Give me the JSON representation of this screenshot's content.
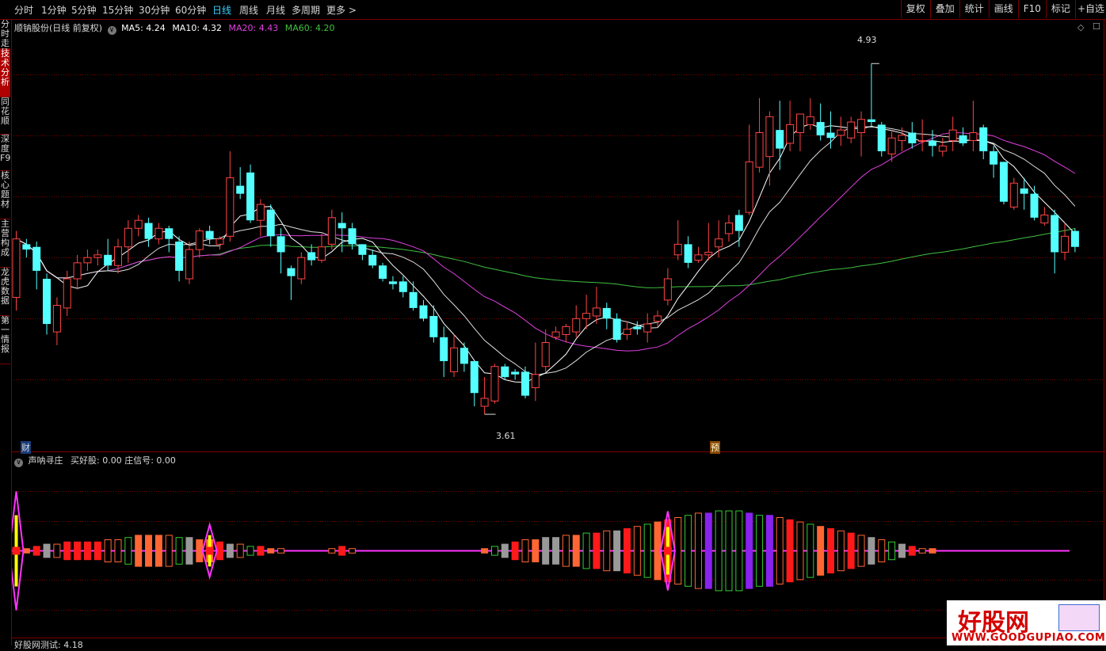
{
  "toolbar": {
    "periods": [
      "分时",
      "1分钟",
      "5分钟",
      "15分钟",
      "30分钟",
      "60分钟",
      "日线",
      "周线",
      "月线",
      "多周期",
      "更多 >"
    ],
    "active_period": "日线",
    "right_tools": [
      "复权",
      "叠加",
      "统计",
      "画线",
      "F10",
      "标记",
      "+自选"
    ]
  },
  "sidebar": {
    "items": [
      "分时走势",
      "技术分析",
      "同花顺",
      "深度F9",
      "核心题材",
      "主营构成",
      "龙虎数据",
      "第一情报"
    ],
    "active": "技术分析"
  },
  "main_panel": {
    "stock_label": "顺钠股份(日线 前复权)",
    "ma": [
      {
        "label": "MA5: 4.24",
        "color": "#ffffff"
      },
      {
        "label": "MA10: 4.32",
        "color": "#ffffff"
      },
      {
        "label": "MA20: 4.43",
        "color": "#e040e0"
      },
      {
        "label": "MA60: 4.20",
        "color": "#40c040"
      }
    ],
    "high_label": "4.93",
    "low_label": "3.61",
    "badge_cai": "财",
    "badge_yu": "预"
  },
  "indicator_panel": {
    "title": "声呐寻庄",
    "values": "买好股: 0.00 庄信号: 0.00"
  },
  "bottom_panel": {
    "title": "好股网测试: 4.18"
  },
  "watermark": {
    "text": "好股网",
    "url": "WWW.GOODGUPIAO.COM"
  },
  "colors": {
    "up": "#ff4444",
    "down": "#54ffff",
    "ma_white": "#ffffff",
    "ma20": "#e040e0",
    "ma60": "#40c040",
    "grid": "#7a0000"
  },
  "chart_data": {
    "type": "candlestick",
    "price_range": [
      3.5,
      5.05
    ],
    "high": 4.93,
    "low": 3.61,
    "candles": [
      [
        4.05,
        4.27,
        4.3,
        4.0
      ],
      [
        4.25,
        4.23,
        4.27,
        4.2
      ],
      [
        4.24,
        4.15,
        4.26,
        4.08
      ],
      [
        4.12,
        3.95,
        4.14,
        3.91
      ],
      [
        3.92,
        4.02,
        4.05,
        3.87
      ],
      [
        4.01,
        4.12,
        4.15,
        3.98
      ],
      [
        4.12,
        4.18,
        4.21,
        4.08
      ],
      [
        4.18,
        4.2,
        4.23,
        4.15
      ],
      [
        4.2,
        4.21,
        4.23,
        4.17
      ],
      [
        4.21,
        4.17,
        4.27,
        4.15
      ],
      [
        4.17,
        4.24,
        4.27,
        4.14
      ],
      [
        4.24,
        4.31,
        4.34,
        4.18
      ],
      [
        4.31,
        4.34,
        4.36,
        4.28
      ],
      [
        4.33,
        4.27,
        4.35,
        4.24
      ],
      [
        4.27,
        4.31,
        4.33,
        4.25
      ],
      [
        4.31,
        4.27,
        4.32,
        4.22
      ],
      [
        4.26,
        4.15,
        4.28,
        4.11
      ],
      [
        4.12,
        4.23,
        4.26,
        4.1
      ],
      [
        4.23,
        4.3,
        4.31,
        4.2
      ],
      [
        4.3,
        4.27,
        4.32,
        4.25
      ],
      [
        4.25,
        4.27,
        4.28,
        4.23
      ],
      [
        4.28,
        4.5,
        4.6,
        4.26
      ],
      [
        4.47,
        4.44,
        4.54,
        4.42
      ],
      [
        4.52,
        4.34,
        4.55,
        4.33
      ],
      [
        4.34,
        4.4,
        4.42,
        4.28
      ],
      [
        4.38,
        4.28,
        4.4,
        4.24
      ],
      [
        4.28,
        4.22,
        4.31,
        4.14
      ],
      [
        4.16,
        4.13,
        4.17,
        4.04
      ],
      [
        4.12,
        4.2,
        4.22,
        4.1
      ],
      [
        4.22,
        4.19,
        4.25,
        4.17
      ],
      [
        4.19,
        4.24,
        4.29,
        4.18
      ],
      [
        4.25,
        4.35,
        4.38,
        4.23
      ],
      [
        4.33,
        4.31,
        4.37,
        4.22
      ],
      [
        4.31,
        4.25,
        4.33,
        4.23
      ],
      [
        4.25,
        4.21,
        4.25,
        4.19
      ],
      [
        4.21,
        4.17,
        4.23,
        4.16
      ],
      [
        4.17,
        4.12,
        4.18,
        4.11
      ],
      [
        4.11,
        4.1,
        4.13,
        4.08
      ],
      [
        4.11,
        4.07,
        4.13,
        4.05
      ],
      [
        4.07,
        4.01,
        4.11,
        4.0
      ],
      [
        4.02,
        3.97,
        4.04,
        3.96
      ],
      [
        3.98,
        3.9,
        4.02,
        3.88
      ],
      [
        3.9,
        3.81,
        3.94,
        3.75
      ],
      [
        3.77,
        3.86,
        3.91,
        3.75
      ],
      [
        3.86,
        3.8,
        3.88,
        3.77
      ],
      [
        3.81,
        3.69,
        3.81,
        3.64
      ],
      [
        3.64,
        3.67,
        3.75,
        3.61
      ],
      [
        3.66,
        3.79,
        3.8,
        3.65
      ],
      [
        3.79,
        3.75,
        3.8,
        3.74
      ],
      [
        3.77,
        3.76,
        3.78,
        3.74
      ],
      [
        3.77,
        3.68,
        3.79,
        3.67
      ],
      [
        3.71,
        3.76,
        3.88,
        3.66
      ],
      [
        3.79,
        3.88,
        3.93,
        3.77
      ],
      [
        3.9,
        3.92,
        3.94,
        3.89
      ],
      [
        3.91,
        3.94,
        3.95,
        3.88
      ],
      [
        3.92,
        3.97,
        4.02,
        3.9
      ],
      [
        3.97,
        3.99,
        4.06,
        3.93
      ],
      [
        3.98,
        4.01,
        4.09,
        3.95
      ],
      [
        4.01,
        3.97,
        4.03,
        3.93
      ],
      [
        3.97,
        3.89,
        3.99,
        3.88
      ],
      [
        3.91,
        3.93,
        3.96,
        3.89
      ],
      [
        3.94,
        3.93,
        3.96,
        3.91
      ],
      [
        3.92,
        3.95,
        3.99,
        3.88
      ],
      [
        3.96,
        3.98,
        4.0,
        3.94
      ],
      [
        4.04,
        4.12,
        4.16,
        4.02
      ],
      [
        4.21,
        4.25,
        4.34,
        4.19
      ],
      [
        4.25,
        4.18,
        4.28,
        4.16
      ],
      [
        4.19,
        4.21,
        4.24,
        4.18
      ],
      [
        4.21,
        4.22,
        4.33,
        4.19
      ],
      [
        4.24,
        4.27,
        4.34,
        4.2
      ],
      [
        4.29,
        4.33,
        4.36,
        4.26
      ],
      [
        4.36,
        4.3,
        4.38,
        4.24
      ],
      [
        4.37,
        4.56,
        4.7,
        4.36
      ],
      [
        4.54,
        4.67,
        4.8,
        4.52
      ],
      [
        4.58,
        4.73,
        4.75,
        4.47
      ],
      [
        4.68,
        4.61,
        4.79,
        4.53
      ],
      [
        4.63,
        4.7,
        4.79,
        4.6
      ],
      [
        4.67,
        4.74,
        4.74,
        4.6
      ],
      [
        4.7,
        4.73,
        4.8,
        4.68
      ],
      [
        4.71,
        4.66,
        4.78,
        4.64
      ],
      [
        4.67,
        4.65,
        4.75,
        4.61
      ],
      [
        4.66,
        4.68,
        4.73,
        4.62
      ],
      [
        4.65,
        4.71,
        4.73,
        4.63
      ],
      [
        4.67,
        4.72,
        4.75,
        4.58
      ],
      [
        4.72,
        4.71,
        4.93,
        4.69
      ],
      [
        4.7,
        4.6,
        4.71,
        4.58
      ],
      [
        4.59,
        4.65,
        4.68,
        4.56
      ],
      [
        4.64,
        4.66,
        4.69,
        4.6
      ],
      [
        4.67,
        4.63,
        4.71,
        4.61
      ],
      [
        4.64,
        4.64,
        4.72,
        4.6
      ],
      [
        4.64,
        4.62,
        4.68,
        4.58
      ],
      [
        4.6,
        4.62,
        4.65,
        4.58
      ],
      [
        4.64,
        4.68,
        4.73,
        4.6
      ],
      [
        4.66,
        4.63,
        4.69,
        4.62
      ],
      [
        4.64,
        4.67,
        4.79,
        4.6
      ],
      [
        4.69,
        4.6,
        4.7,
        4.57
      ],
      [
        4.6,
        4.55,
        4.62,
        4.5
      ],
      [
        4.56,
        4.41,
        4.56,
        4.4
      ],
      [
        4.39,
        4.48,
        4.5,
        4.38
      ],
      [
        4.46,
        4.44,
        4.5,
        4.38
      ],
      [
        4.44,
        4.35,
        4.47,
        4.34
      ],
      [
        4.33,
        4.36,
        4.39,
        4.32
      ],
      [
        4.36,
        4.22,
        4.38,
        4.14
      ],
      [
        4.22,
        4.28,
        4.33,
        4.19
      ],
      [
        4.3,
        4.24,
        4.31,
        4.22
      ]
    ],
    "signals": [
      [
        2,
        0,
        0
      ],
      [
        2,
        1,
        0
      ],
      [
        2,
        2,
        0
      ],
      [
        2,
        3,
        0
      ],
      [
        1,
        3,
        1
      ],
      [
        1,
        4,
        0
      ],
      [
        1,
        4,
        0
      ],
      [
        1,
        4,
        0
      ],
      [
        1,
        4,
        0
      ],
      [
        1,
        5,
        1
      ],
      [
        0,
        5,
        1
      ],
      [
        0,
        6,
        1
      ],
      [
        0,
        7,
        0
      ],
      [
        0,
        7,
        0
      ],
      [
        0,
        7,
        0
      ],
      [
        0,
        7,
        1
      ],
      [
        0,
        6,
        1
      ],
      [
        0,
        6,
        0
      ],
      [
        1,
        5,
        0
      ],
      [
        1,
        5,
        0
      ],
      [
        2,
        4,
        0
      ],
      [
        2,
        3,
        0
      ],
      [
        2,
        3,
        1
      ],
      [
        1,
        2,
        1
      ],
      [
        1,
        2,
        0
      ],
      [
        1,
        1,
        0
      ],
      [
        1,
        1,
        1
      ],
      [
        2,
        0,
        0
      ],
      [
        1,
        0,
        0
      ],
      [
        0,
        0,
        0
      ],
      [
        0,
        0,
        0
      ],
      [
        0,
        1,
        1
      ],
      [
        0,
        2,
        0
      ],
      [
        0,
        1,
        1
      ],
      [
        0,
        0,
        0
      ],
      [
        1,
        0,
        0
      ],
      [
        0,
        0,
        0
      ],
      [
        0,
        0,
        0
      ],
      [
        0,
        0,
        0
      ],
      [
        0,
        0,
        0
      ],
      [
        0,
        0,
        0
      ],
      [
        0,
        0,
        0
      ],
      [
        0,
        0,
        0
      ],
      [
        0,
        0,
        0
      ],
      [
        0,
        0,
        0
      ],
      [
        0,
        0,
        0
      ],
      [
        0,
        1,
        0
      ],
      [
        0,
        2,
        1
      ],
      [
        0,
        3,
        0
      ],
      [
        0,
        4,
        0
      ],
      [
        0,
        5,
        1
      ],
      [
        0,
        5,
        0
      ],
      [
        0,
        6,
        0
      ],
      [
        0,
        6,
        0
      ],
      [
        0,
        7,
        1
      ],
      [
        0,
        7,
        0
      ],
      [
        0,
        8,
        1
      ],
      [
        0,
        8,
        0
      ],
      [
        0,
        9,
        1
      ],
      [
        0,
        9,
        0
      ],
      [
        0,
        10,
        0
      ],
      [
        0,
        11,
        1
      ],
      [
        0,
        12,
        1
      ],
      [
        0,
        13,
        0
      ],
      [
        0,
        14,
        0
      ],
      [
        0,
        15,
        1
      ],
      [
        0,
        16,
        1
      ],
      [
        0,
        17,
        1
      ],
      [
        0,
        17,
        0
      ],
      [
        3,
        18,
        1
      ],
      [
        3,
        18,
        1
      ],
      [
        2,
        18,
        1
      ],
      [
        2,
        17,
        0
      ],
      [
        1,
        16,
        1
      ],
      [
        1,
        16,
        0
      ],
      [
        1,
        15,
        1
      ],
      [
        1,
        14,
        0
      ],
      [
        1,
        13,
        1
      ],
      [
        1,
        12,
        1
      ],
      [
        1,
        11,
        0
      ],
      [
        1,
        10,
        0
      ],
      [
        2,
        9,
        1
      ],
      [
        2,
        8,
        0
      ],
      [
        2,
        7,
        1
      ],
      [
        2,
        6,
        0
      ],
      [
        2,
        5,
        1
      ],
      [
        2,
        4,
        1
      ],
      [
        2,
        3,
        0
      ],
      [
        2,
        2,
        0
      ],
      [
        1,
        1,
        1
      ],
      [
        1,
        1,
        0
      ],
      [
        0,
        0,
        0
      ],
      [
        0,
        0,
        0
      ],
      [
        0,
        0,
        0
      ],
      [
        0,
        0,
        0
      ],
      [
        0,
        0,
        0
      ],
      [
        0,
        0,
        0
      ],
      [
        0,
        0,
        0
      ],
      [
        0,
        0,
        0
      ],
      [
        0,
        0,
        0
      ],
      [
        0,
        0,
        0
      ],
      [
        0,
        0,
        0
      ],
      [
        0,
        0,
        0
      ],
      [
        0,
        0,
        0
      ]
    ]
  }
}
